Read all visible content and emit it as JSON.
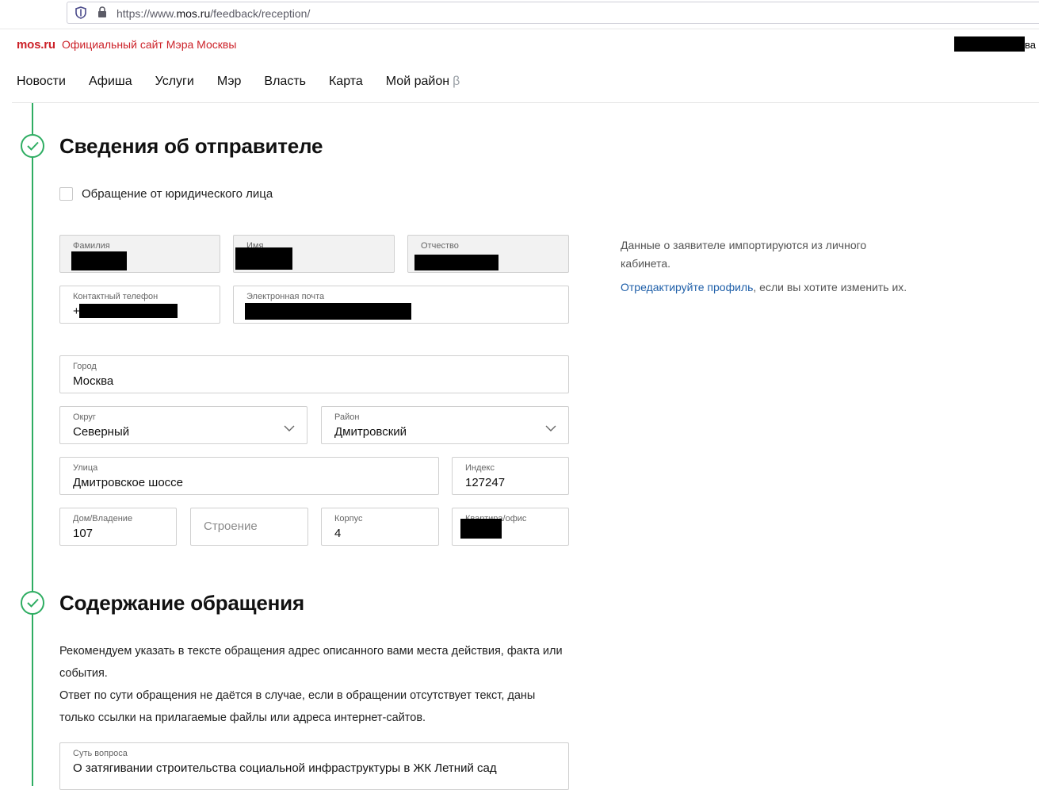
{
  "browser": {
    "url_prefix": "https://www.",
    "url_domain": "mos.ru",
    "url_path": "/feedback/reception/"
  },
  "header": {
    "logo": "mos.ru",
    "site_title": "Официальный сайт Мэра Москвы",
    "user_suffix": "ва"
  },
  "nav": {
    "items": [
      "Новости",
      "Афиша",
      "Услуги",
      "Мэр",
      "Власть",
      "Карта",
      "Мой район"
    ],
    "beta_mark": "β"
  },
  "sender": {
    "title": "Сведения об отправителе",
    "legal_entity_label": "Обращение от юридического лица",
    "legal_entity_checked": false,
    "surname_label": "Фамилия",
    "name_label": "Имя",
    "patronymic_label": "Отчество",
    "phone_label": "Контактный телефон",
    "phone_prefix": "+",
    "email_label": "Электронная почта",
    "city_label": "Город",
    "city_value": "Москва",
    "district_label": "Округ",
    "district_value": "Северный",
    "area_label": "Район",
    "area_value": "Дмитровский",
    "street_label": "Улица",
    "street_value": "Дмитровское шоссе",
    "zip_label": "Индекс",
    "zip_value": "127247",
    "house_label": "Дом/Владение",
    "house_value": "107",
    "building_placeholder": "Строение",
    "block_label": "Корпус",
    "block_value": "4",
    "apartment_label": "Квартира/офис"
  },
  "side": {
    "note": "Данные о заявителе импортируются из личного кабинета.",
    "link": "Отредактируйте профиль",
    "link_suffix": ", если вы хотите изменить их."
  },
  "content": {
    "title": "Содержание обращения",
    "para1": "Рекомендуем указать в тексте обращения адрес описанного вами места действия, факта или события.",
    "para2": "Ответ по сути обращения не даётся в случае, если в обращении отсутствует текст, даны только ссылки на прилагаемые файлы или адреса интернет-сайтов.",
    "question_label": "Суть вопроса",
    "question_value": "О затягивании строительства социальной инфраструктуры в ЖК Летний сад"
  },
  "colors": {
    "brand_red": "#cc2229",
    "step_green": "#2ead62",
    "link_blue": "#1d5ea8"
  }
}
